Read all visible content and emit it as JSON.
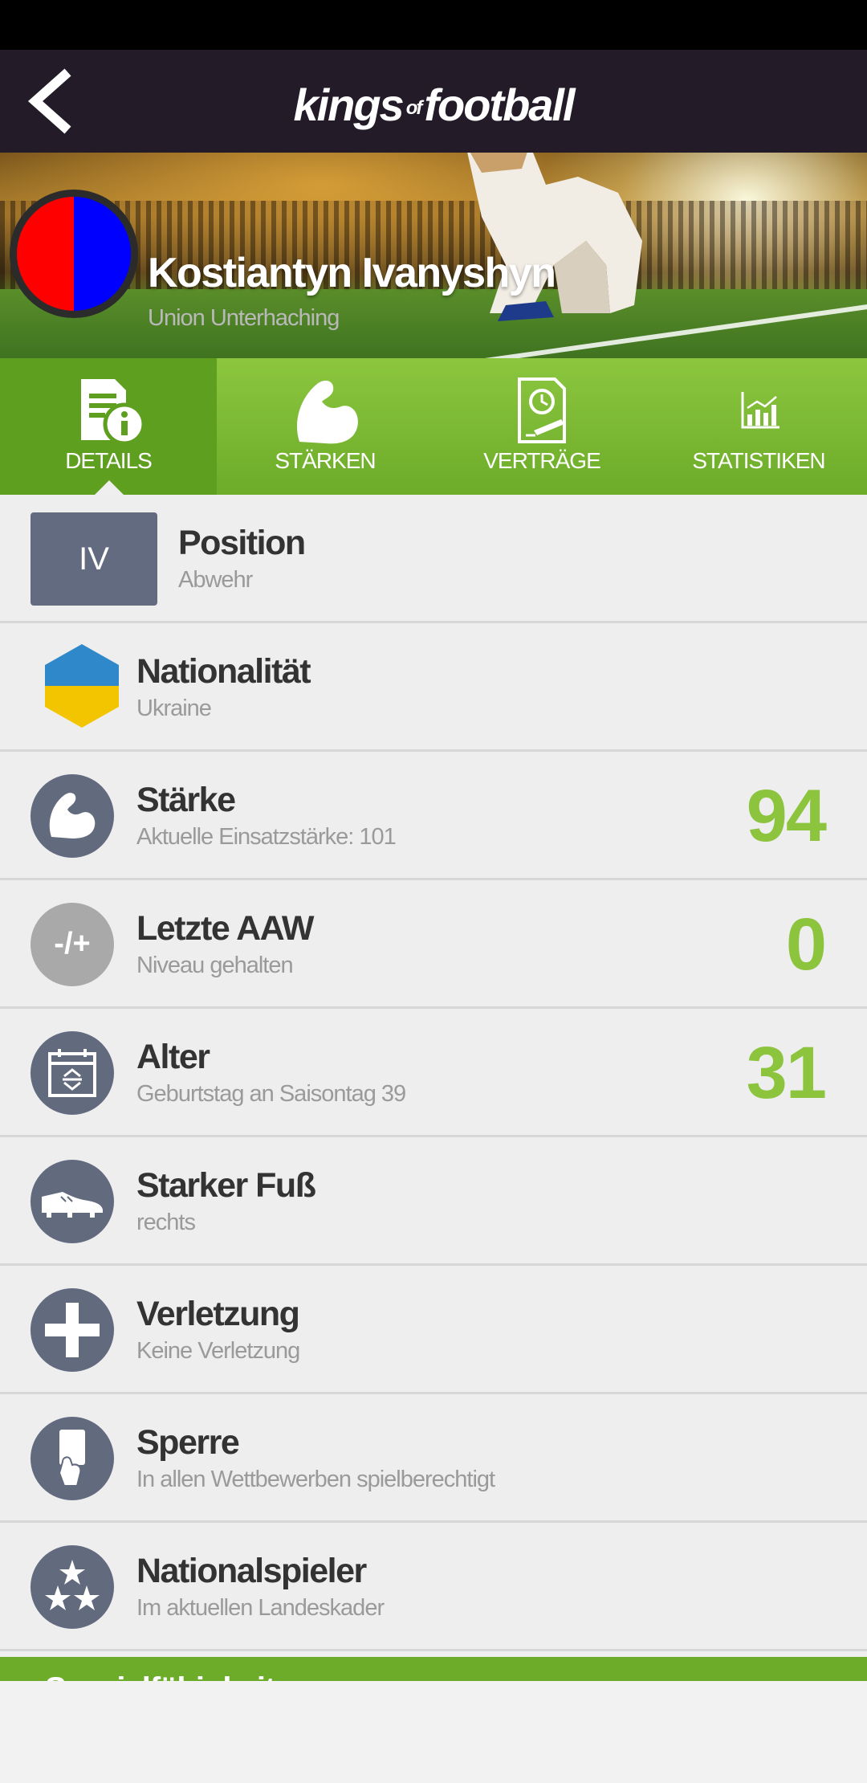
{
  "app": {
    "brand_left": "kings",
    "brand_of": "of",
    "brand_right": "football"
  },
  "player": {
    "name": "Kostiantyn Ivanyshyn",
    "club": "Union Unterhaching"
  },
  "tabs": [
    {
      "label": "DETAILS",
      "icon": "document-info-icon",
      "active": true
    },
    {
      "label": "STÄRKEN",
      "icon": "biceps-icon",
      "active": false
    },
    {
      "label": "VERTRÄGE",
      "icon": "contract-clock-icon",
      "active": false
    },
    {
      "label": "STATISTIKEN",
      "icon": "bar-chart-icon",
      "active": false
    }
  ],
  "rows": {
    "position": {
      "badge": "IV",
      "title": "Position",
      "subtitle": "Abwehr"
    },
    "nationality": {
      "title": "Nationalität",
      "subtitle": "Ukraine",
      "flag_colors": [
        "#2f88c9",
        "#f2c500"
      ]
    },
    "strength": {
      "title": "Stärke",
      "subtitle": "Aktuelle Einsatzstärke: 101",
      "value": "94"
    },
    "last_aaw": {
      "icon_text": "-/+",
      "title": "Letzte AAW",
      "subtitle": "Niveau gehalten",
      "value": "0"
    },
    "age": {
      "title": "Alter",
      "subtitle": "Geburtstag an Saisontag 39",
      "value": "31"
    },
    "foot": {
      "title": "Starker Fuß",
      "subtitle": "rechts"
    },
    "injury": {
      "title": "Verletzung",
      "subtitle": "Keine Verletzung"
    },
    "ban": {
      "title": "Sperre",
      "subtitle": "In allen Wettbewerben spielberechtigt"
    },
    "national": {
      "title": "Nationalspieler",
      "subtitle": "Im aktuellen Landeskader"
    }
  },
  "section_next": {
    "label": "Spezialfähigkeiten"
  },
  "colors": {
    "accent_green": "#8dc43e",
    "tab_green": "#6cac29",
    "icon_slate": "#626a7e",
    "topbar": "#231c28",
    "club_red": "#ff0000",
    "club_blue": "#0000ff"
  }
}
